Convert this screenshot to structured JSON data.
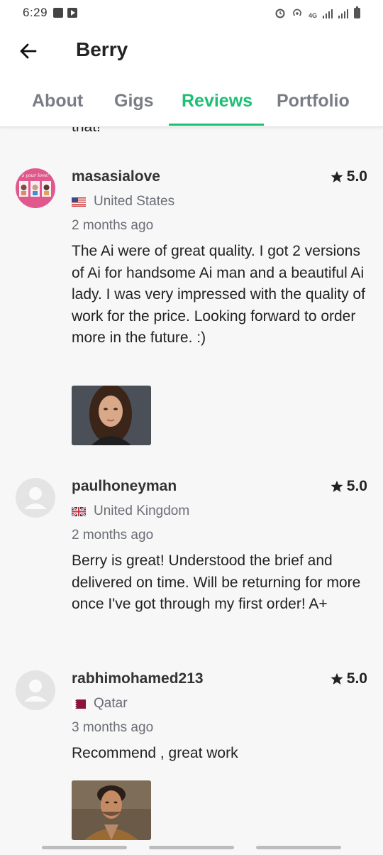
{
  "status_bar": {
    "time": "6:29",
    "network": "4G",
    "icons": [
      "image-icon",
      "youtube-icon",
      "alarm-icon",
      "hotspot-icon",
      "signal-icon",
      "signal-icon",
      "battery-icon"
    ]
  },
  "header": {
    "title": "Berry",
    "back_icon": "arrow-left-icon"
  },
  "tabs": [
    {
      "label": "About",
      "active": false
    },
    {
      "label": "Gigs",
      "active": false
    },
    {
      "label": "Reviews",
      "active": true
    },
    {
      "label": "Portfolio",
      "active": false
    }
  ],
  "colors": {
    "accent": "#1dbf73",
    "tab_inactive": "#7a7d85",
    "text": "#222222",
    "muted": "#6a6d75",
    "background": "#f7f7f7"
  },
  "clipped_text": "that!",
  "reviews": [
    {
      "username": "masasialove",
      "rating": "5.0",
      "country": "United States",
      "time_ago": "2 months ago",
      "text": "The Ai were of great quality. I got 2 versions of Ai for handsome Ai man and a beautiful Ai lady. I was very impressed with the quality of work for the price. Looking forward to order more in the future. :)",
      "avatar_label": "s your love!"
    },
    {
      "username": "paulhoneyman",
      "rating": "5.0",
      "country": "United Kingdom",
      "time_ago": "2 months ago",
      "text": "Berry is great! Understood the brief and delivered on time. Will be returning for more once I've got through my first order! A+"
    },
    {
      "username": "rabhimohamed213",
      "rating": "5.0",
      "country": "Qatar",
      "time_ago": "3 months ago",
      "text": "Recommend , great work"
    }
  ]
}
